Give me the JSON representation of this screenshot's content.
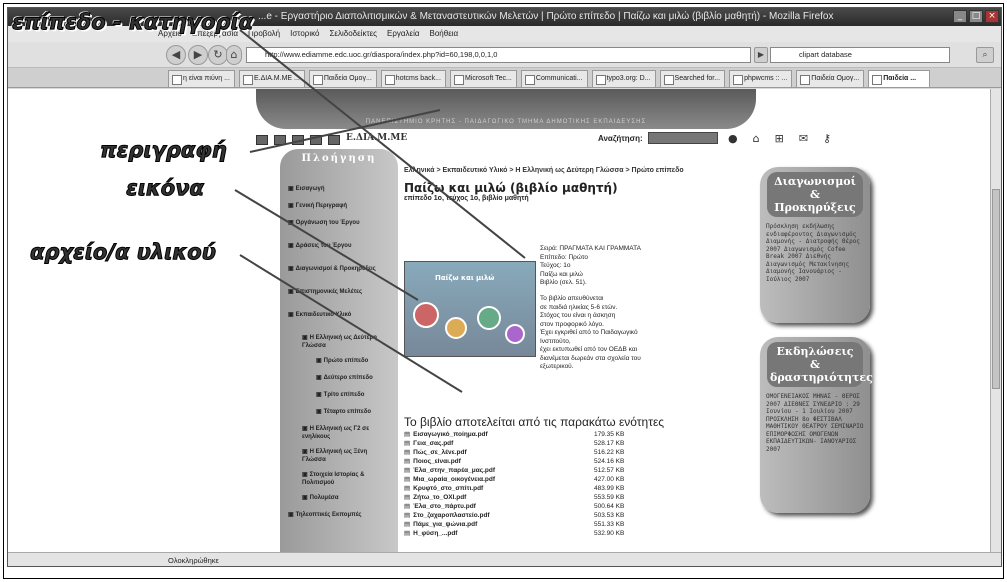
{
  "window": {
    "title": "...e - Εργαστήριο Διαπολιτισμικών & Μεταναστευτικών Μελετών | Πρώτο επίπεδο | Παίζω και μιλώ (βιβλίο μαθητή) - Mozilla Firefox",
    "controls": [
      "_",
      "□",
      "×"
    ]
  },
  "menubar": [
    "Αρχείο",
    "Επεξεργασία",
    "Προβολή",
    "Ιστορικό",
    "Σελιδοδείκτες",
    "Εργαλεία",
    "Βοήθεια"
  ],
  "navbar": {
    "url": "http://www.ediamme.edc.uoc.gr/diaspora/index.php?id=60,198,0,0,1,0",
    "search_value": "clipart database"
  },
  "tabs": [
    {
      "label": "η είναι πιύνη ...",
      "active": false
    },
    {
      "label": "E.ΔΙΑ.Μ.ΜΕ ...",
      "active": false
    },
    {
      "label": "Παιδεία Ομογ...",
      "active": false
    },
    {
      "label": "hotcms back...",
      "active": false
    },
    {
      "label": "Microsoft Tec...",
      "active": false
    },
    {
      "label": "Communicati...",
      "active": false
    },
    {
      "label": "typo3.org: D...",
      "active": false
    },
    {
      "label": "Searched for...",
      "active": false
    },
    {
      "label": "phpwcms :: ...",
      "active": false
    },
    {
      "label": "Παιδεία Ομογ...",
      "active": false
    },
    {
      "label": "Παιδεία ...",
      "active": true
    }
  ],
  "site": {
    "header_text": "ΠΑΝΕΠΙΣΤΗΜΙΟ ΚΡΗΤΗΣ - ΠΑΙΔΑΓΩΓΙΚΟ ΤΜΗΜΑ ΔΗΜΟΤΙΚΗΣ ΕΚΠΑΙΔΕΥΣΗΣ",
    "brand": "Ε.ΔΙΑ.Μ.ΜΕ",
    "search_label": "Αναζήτηση:",
    "top_icons": [
      "go-icon",
      "home-icon",
      "sitemap-icon",
      "mail-icon",
      "key-icon"
    ]
  },
  "leftnav": {
    "title": "Πλοήγηση",
    "items": [
      {
        "label": "Εισαγωγή",
        "level": 0
      },
      {
        "label": "Γενική Περιγραφή",
        "level": 0
      },
      {
        "label": "Οργάνωση του Έργου",
        "level": 0
      },
      {
        "label": "Δράσεις του Έργου",
        "level": 0
      },
      {
        "label": "Διαγωνισμοί & Προκηρύξεις",
        "level": 0
      },
      {
        "label": "Επιστημονικές Μελέτες",
        "level": 0
      },
      {
        "label": "Εκπαιδευτικό Υλικό",
        "level": 0
      },
      {
        "label": "Η Ελληνική ως Δεύτερη Γλώσσα",
        "level": 1
      },
      {
        "label": "Πρώτο επίπεδο",
        "level": 2
      },
      {
        "label": "Δεύτερο επίπεδο",
        "level": 2
      },
      {
        "label": "Τρίτο επίπεδο",
        "level": 2
      },
      {
        "label": "Τέταρτο επίπεδο",
        "level": 2
      },
      {
        "label": "Η Ελληνική ως Γ2 σε ενηλίκους",
        "level": 1
      },
      {
        "label": "Η Ελληνική ως Ξένη Γλώσσα",
        "level": 1
      },
      {
        "label": "Στοιχεία Ιστορίας & Πολιτισμού",
        "level": 1
      },
      {
        "label": "Πολυμέσα",
        "level": 1
      },
      {
        "label": "Τηλεοπτικές Εκπομπές",
        "level": 0
      }
    ]
  },
  "main": {
    "breadcrumb": "Ελληνικά > Εκπαιδευτικό Υλικό > Η Ελληνική ως Δεύτερη Γλώσσα > Πρώτο επίπεδο",
    "title": "Παίζω και μιλώ (βιβλίο μαθητή)",
    "subtitle": "επίπεδο 1ο, τεύχος 1ο, βιβλίο μαθητή",
    "cover_title": "Παίζω και μιλώ",
    "meta": [
      "Σειρά: ΠΡΑΓΜΑΤΑ ΚΑΙ ΓΡΑΜΜΑΤΑ",
      "Επίπεδο: Πρώτο",
      "Τεύχος: 1ο",
      "Παίζω και μιλώ",
      "Βιβλίο (σελ. 51)."
    ],
    "description": [
      "Το βιβλίο απευθύνεται",
      "σε παιδιά ηλικίας 5-6 ετών.",
      "Στόχος του είναι η άσκηση",
      "στον προφορικό λόγο.",
      "Έχει εγκριθεί από το Παιδαγωγικό",
      "Ινστιτούτο,",
      "έχει εκτυπωθεί από τον ΟΕΔΒ και",
      "διανέμεται δωρεάν στα σχολεία του",
      "εξωτερικού."
    ],
    "units_heading": "Το βιβλίο αποτελείται από τις παρακάτω ενότητες",
    "files": [
      {
        "name": "Εισαγωγικό_ποίημα.pdf",
        "size": "179.35 KB"
      },
      {
        "name": "Γεια_σας.pdf",
        "size": "528.17 KB"
      },
      {
        "name": "Πώς_σε_λένε.pdf",
        "size": "516.22 KB"
      },
      {
        "name": "Ποιος_είναι.pdf",
        "size": "524.16 KB"
      },
      {
        "name": "Έλα_στην_παρέα_μας.pdf",
        "size": "512.57 KB"
      },
      {
        "name": "Μια_ωραία_οικογένεια.pdf",
        "size": "427.00 KB"
      },
      {
        "name": "Κρυφτό_στο_σπίτι.pdf",
        "size": "483.99 KB"
      },
      {
        "name": "Ζήτω_το_ΟΧΙ.pdf",
        "size": "553.59 KB"
      },
      {
        "name": "Έλα_στο_πάρτυ.pdf",
        "size": "500.64 KB"
      },
      {
        "name": "Στο_ζαχαροπλαστείο.pdf",
        "size": "503.53 KB"
      },
      {
        "name": "Πάμε_για_ψώνια.pdf",
        "size": "551.33 KB"
      },
      {
        "name": "Η_φύση_...pdf",
        "size": "532.90 KB"
      }
    ]
  },
  "right_panels": [
    {
      "title": "Διαγωνισμοί & Προκηρύξεις",
      "body": "Πρόσκληση εκδήλωσης ενδιαφέροντος Διαγωνισμός Διαμονής - Διατροφής Θέρος 2007 Διαγωνισμός Cofee Break 2007 Διεθνής Διαγωνισμός Μετακίνησης Διαμονής Ιανουάριος - Ιούλιος 2007"
    },
    {
      "title": "Εκδηλώσεις & δραστηριότητες",
      "body": "ΟΜΟΓΕΝΕΙΑΚΟΣ ΜΗΝΑΣ - ΘΕΡΟΣ 2007 ΔΙΕΘΝΕΣ ΣΥΝΕΔΡΙΟ : 29 Ιουνίου - 1 Ιουλίου 2007 ΠΡΟΣΚΛΗΣΗ 8ο ΦΕΣΤΙΒΑΛ ΜΑΘΗΤΙΚΟΥ ΘΕΑΤΡΟΥ ΣΕΜΙΝΑΡΙΟ ΕΠΙΜΟΡΦΩΣΗΣ ΟΜΟΓΕΝΩΝ ΕΚΠΑΙΔΕΥΤΙΚΩΝ- ΙΑΝΟΥΑΡΙΟΣ 2007"
    }
  ],
  "status": "Ολοκληρώθηκε",
  "annotations": {
    "level_category": "επίπεδο - κατηγορία",
    "description": "περιγραφή",
    "image": "εικόνα",
    "material_files": "αρχείο/α υλικού"
  },
  "colors": {
    "annotation_fill": "#333333",
    "titlebar": "#3a3a3a",
    "panel_gray": "#9a9a9a"
  }
}
